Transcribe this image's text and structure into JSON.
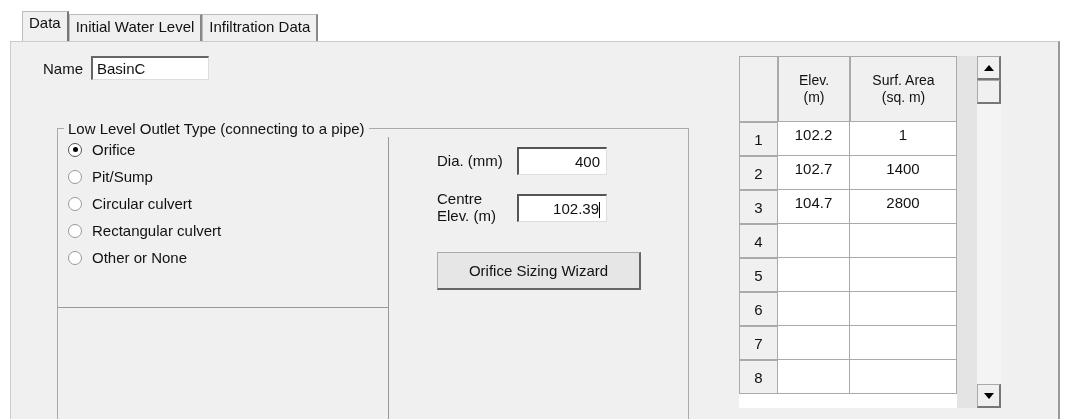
{
  "tabs": [
    {
      "label": "Data",
      "selected": true
    },
    {
      "label": "Initial Water Level",
      "selected": false
    },
    {
      "label": "Infiltration Data",
      "selected": false
    }
  ],
  "name_field": {
    "label": "Name",
    "value": "BasinC"
  },
  "outlet_group": {
    "title": "Low Level Outlet Type (connecting to a pipe)",
    "options": [
      {
        "label": "Orifice",
        "selected": true
      },
      {
        "label": "Pit/Sump",
        "selected": false
      },
      {
        "label": "Circular culvert",
        "selected": false
      },
      {
        "label": "Rectangular culvert",
        "selected": false
      },
      {
        "label": "Other or None",
        "selected": false
      }
    ],
    "fields": [
      {
        "label": "Dia. (mm)",
        "value": "400",
        "focused": false
      },
      {
        "label": "Centre Elev. (m)",
        "value": "102.39",
        "focused": true
      }
    ],
    "button": "Orifice Sizing Wizard"
  },
  "table": {
    "columns": [
      "Elev. (m)",
      "Surf. Area (sq. m)"
    ],
    "rows": [
      {
        "number": "1",
        "elev": "102.2",
        "area": "1"
      },
      {
        "number": "2",
        "elev": "102.7",
        "area": "1400"
      },
      {
        "number": "3",
        "elev": "104.7",
        "area": "2800"
      },
      {
        "number": "4"
      },
      {
        "number": "5"
      },
      {
        "number": "6"
      },
      {
        "number": "7"
      },
      {
        "number": "8"
      }
    ]
  }
}
